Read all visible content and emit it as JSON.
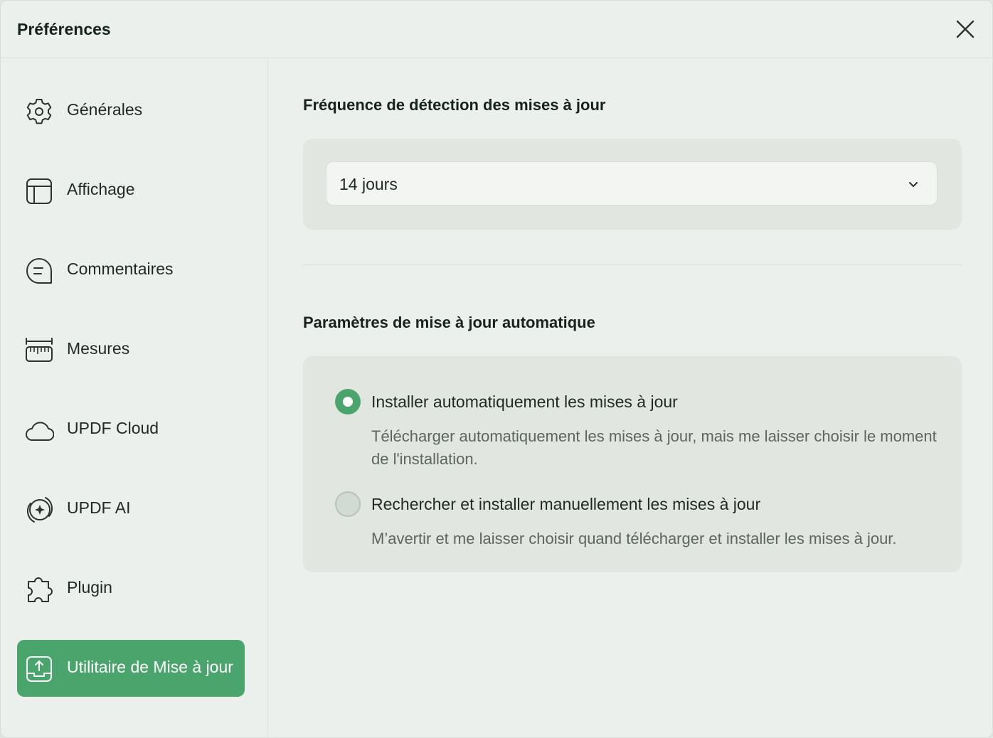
{
  "window": {
    "title": "Préférences"
  },
  "sidebar": {
    "items": [
      {
        "label": "Générales",
        "icon": "gear-icon"
      },
      {
        "label": "Affichage",
        "icon": "layout-icon"
      },
      {
        "label": "Commentaires",
        "icon": "comment-icon"
      },
      {
        "label": "Mesures",
        "icon": "ruler-icon"
      },
      {
        "label": "UPDF Cloud",
        "icon": "cloud-icon"
      },
      {
        "label": "UPDF AI",
        "icon": "ai-icon"
      },
      {
        "label": "Plugin",
        "icon": "puzzle-icon"
      },
      {
        "label": "Utilitaire de Mise à jour",
        "icon": "update-icon",
        "active": true
      }
    ]
  },
  "main": {
    "frequency": {
      "title": "Fréquence de détection des mises à jour",
      "selected": "14 jours"
    },
    "auto_update": {
      "title": "Paramètres de mise à jour automatique",
      "options": [
        {
          "label": "Installer automatiquement les mises à jour",
          "description": "Télécharger automatiquement les mises à jour, mais me laisser choisir le moment de l'installation.",
          "selected": true
        },
        {
          "label": "Rechercher et installer manuellement les mises à jour",
          "description": "M’avertir et me laisser choisir quand télécharger et installer les mises à jour.",
          "selected": false
        }
      ]
    }
  },
  "colors": {
    "accent": "#4aa56c",
    "background": "#ecf0ec",
    "card": "#e1e6e1"
  }
}
